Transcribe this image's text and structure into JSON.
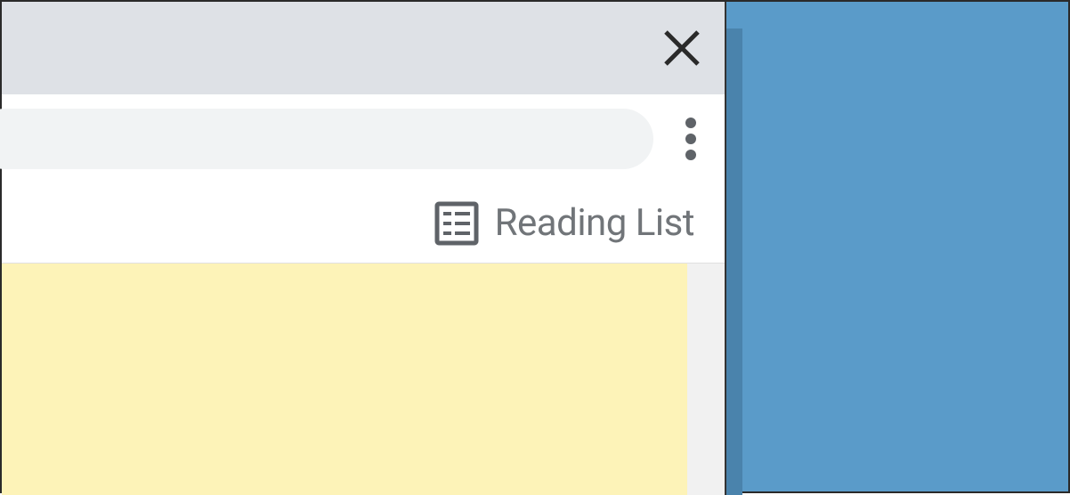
{
  "bookmarks_bar": {
    "reading_list_label": "Reading List"
  }
}
